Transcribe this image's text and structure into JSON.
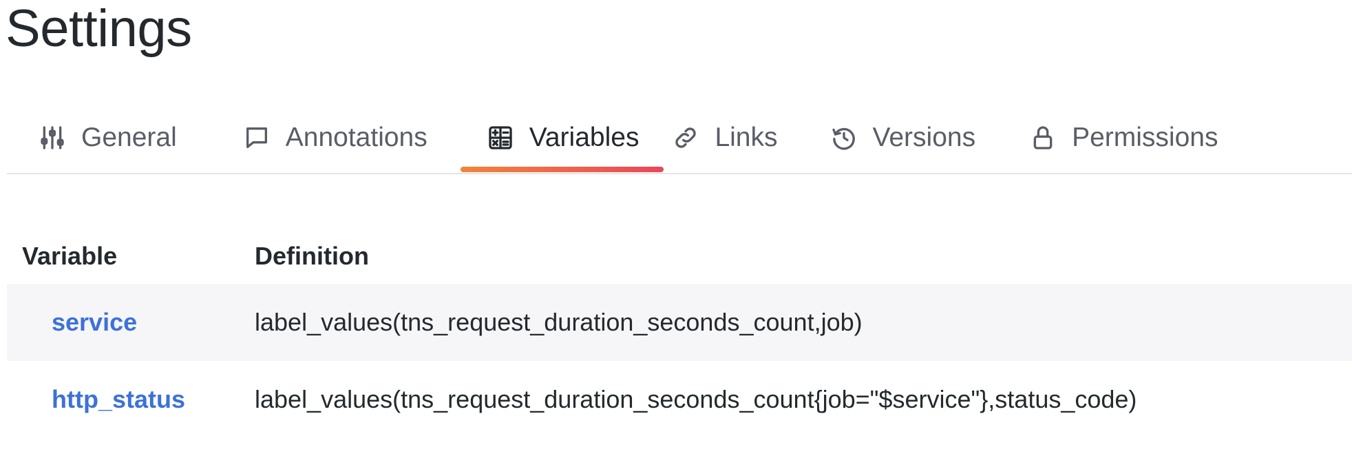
{
  "page": {
    "title": "Settings"
  },
  "tabs": [
    {
      "label": "General",
      "icon": "sliders-icon"
    },
    {
      "label": "Annotations",
      "icon": "comment-icon"
    },
    {
      "label": "Variables",
      "icon": "calculator-icon",
      "active": true
    },
    {
      "label": "Links",
      "icon": "link-icon"
    },
    {
      "label": "Versions",
      "icon": "history-icon"
    },
    {
      "label": "Permissions",
      "icon": "lock-icon"
    }
  ],
  "table": {
    "headers": {
      "variable": "Variable",
      "definition": "Definition"
    },
    "rows": [
      {
        "variable": "service",
        "definition": "label_values(tns_request_duration_seconds_count,job)"
      },
      {
        "variable": "http_status",
        "definition": "label_values(tns_request_duration_seconds_count{job=\"$service\"},status_code)"
      }
    ]
  },
  "colors": {
    "link": "#3d71d9",
    "active_tab_gradient_start": "#f1853a",
    "active_tab_gradient_end": "#e9475a",
    "row_stripe": "#f6f6f8"
  }
}
